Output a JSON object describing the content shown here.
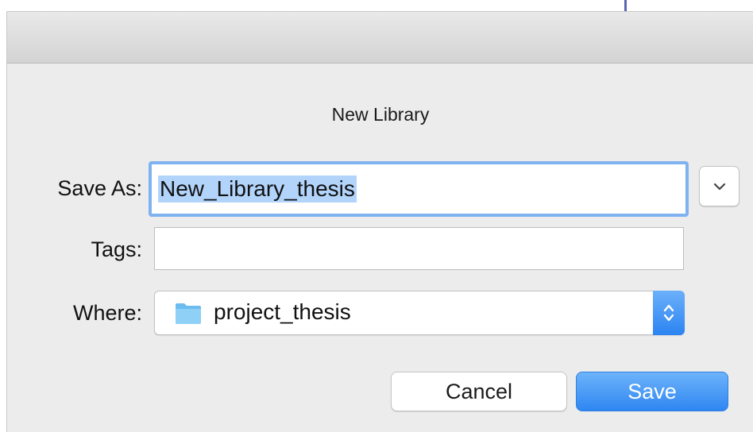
{
  "dialog": {
    "title": "New Library",
    "save_as": {
      "label": "Save As:",
      "value": "New_Library_thesis"
    },
    "tags": {
      "label": "Tags:",
      "value": ""
    },
    "where": {
      "label": "Where:",
      "value": "project_thesis",
      "icon": "folder-icon"
    },
    "buttons": {
      "cancel": "Cancel",
      "save": "Save"
    },
    "colors": {
      "accent": "#2f86f1",
      "selection": "#b2d4fb",
      "focus_ring": "#7fb2f0",
      "folder": "#7cc4f2"
    }
  }
}
